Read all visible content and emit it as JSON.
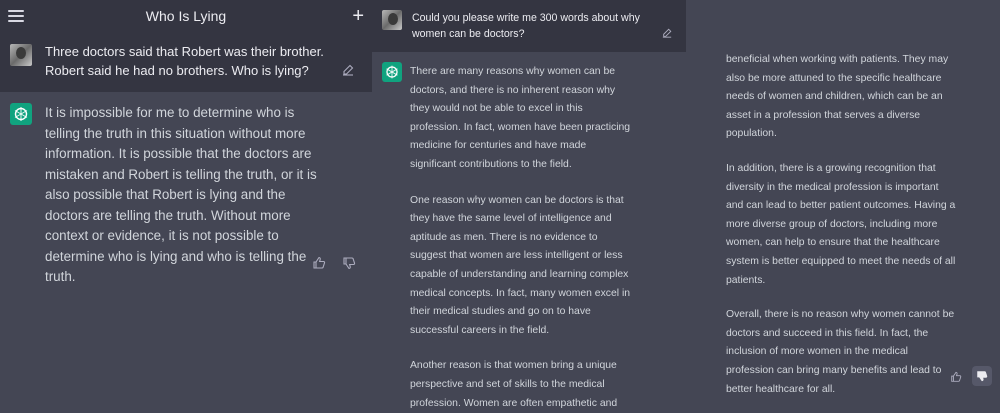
{
  "left": {
    "header": {
      "title": "Who Is Lying"
    },
    "user_message": "Three doctors said that Robert was their brother. Robert said he had no brothers. Who is lying?",
    "assistant_message": "It is impossible for me to determine who is telling the truth in this situation without more information. It is possible that the doctors are mistaken and Robert is telling the truth, or it is also possible that Robert is lying and the doctors are telling the truth. Without more context or evidence, it is not possible to determine who is lying and who is telling the truth."
  },
  "middle": {
    "user_message": "Could you please write me 300 words about why women can be doctors?",
    "paragraphs": [
      "There are many reasons why women can be doctors, and there is no inherent reason why they would not be able to excel in this profession. In fact, women have been practicing medicine for centuries and have made significant contributions to the field.",
      "One reason why women can be doctors is that they have the same level of intelligence and aptitude as men. There is no evidence to suggest that women are less intelligent or less capable of understanding and learning complex medical concepts. In fact, many women excel in their medical studies and go on to have successful careers in the field.",
      "Another reason is that women bring a unique perspective and set of skills to the medical profession. Women are often empathetic and compassionate caregivers, which can be"
    ]
  },
  "right": {
    "paragraphs": [
      "beneficial when working with patients. They may also be more attuned to the specific healthcare needs of women and children, which can be an asset in a profession that serves a diverse population.",
      "In addition, there is a growing recognition that diversity in the medical profession is important and can lead to better patient outcomes. Having a more diverse group of doctors, including more women, can help to ensure that the healthcare system is better equipped to meet the needs of all patients.",
      "Overall, there is no reason why women cannot be doctors and succeed in this field. In fact, the inclusion of more women in the medical profession can bring many benefits and lead to better healthcare for all."
    ]
  }
}
